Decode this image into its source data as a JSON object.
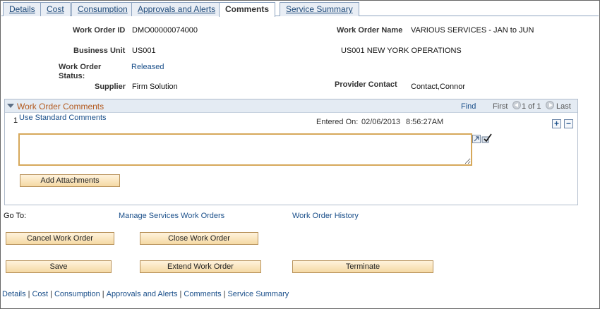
{
  "tabs": [
    {
      "label": "Details"
    },
    {
      "label": "Cost"
    },
    {
      "label": "Consumption"
    },
    {
      "label": "Approvals and Alerts"
    },
    {
      "label": "Comments",
      "active": true
    },
    {
      "label": "Service Summary"
    }
  ],
  "header": {
    "work_order_id_label": "Work Order ID",
    "work_order_id": "DMO00000074000",
    "work_order_name_label": "Work Order Name",
    "work_order_name": "VARIOUS SERVICES - JAN to JUN",
    "business_unit_label": "Business Unit",
    "business_unit": "US001",
    "business_unit_desc": "US001 NEW YORK OPERATIONS",
    "status_label_1": "Work Order",
    "status_label_2": "Status:",
    "status": "Released",
    "supplier_label": "Supplier",
    "supplier": "Firm Solution",
    "provider_contact_label": "Provider Contact",
    "provider_contact": "Contact,Connor"
  },
  "comments": {
    "title": "Work Order Comments",
    "find": "Find",
    "first": "First",
    "count": "1 of 1",
    "last": "Last",
    "row_number": "1",
    "use_standard": "Use Standard Comments",
    "entered_on_label": "Entered On:",
    "entered_on": "02/06/2013",
    "entered_time": "8:56:27AM",
    "comment_text": "",
    "add_attachments": "Add Attachments",
    "plus": "+",
    "minus": "−"
  },
  "goto": {
    "label": "Go To:",
    "manage": "Manage Services Work Orders",
    "history": "Work Order History"
  },
  "buttons": {
    "cancel": "Cancel Work Order",
    "close": "Close Work Order",
    "save": "Save",
    "extend": "Extend Work Order",
    "terminate": "Terminate"
  },
  "footer": [
    "Details",
    "Cost",
    "Consumption",
    "Approvals and Alerts",
    "Comments",
    "Service Summary"
  ],
  "colors": {
    "accent_title": "#b35a1f",
    "link": "#1a4f8a",
    "button_bg": "#f5d9a4"
  }
}
